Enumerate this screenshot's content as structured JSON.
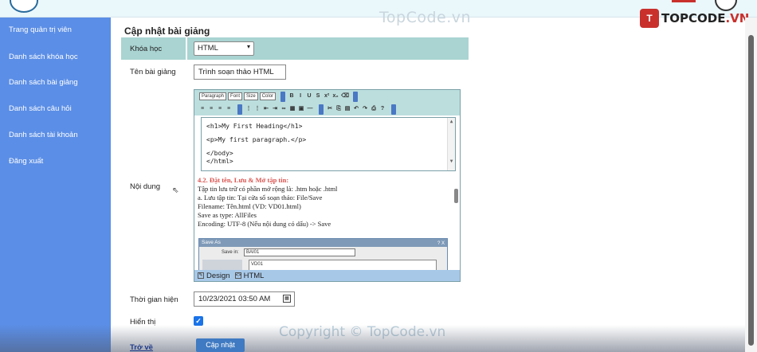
{
  "watermarks": {
    "top": "TopCode.vn",
    "bottom": "Copyright © TopCode.vn"
  },
  "brand": {
    "badge": "T",
    "text_main": "TOPCODE",
    "text_suffix": ".VN"
  },
  "sidebar": {
    "items": [
      {
        "label": "Trang quản trị viên"
      },
      {
        "label": "Danh sách khóa học"
      },
      {
        "label": "Danh sách bài giảng"
      },
      {
        "label": "Danh sách câu hỏi"
      },
      {
        "label": "Danh sách tài khoản"
      },
      {
        "label": "Đăng xuất"
      }
    ]
  },
  "page": {
    "title": "Cập nhật bài giảng"
  },
  "form": {
    "course_label": "Khóa học",
    "course_value": "HTML",
    "lesson_name_label": "Tên bài giảng",
    "lesson_name_value": "Trình soạn thảo HTML",
    "content_label": "Nội dung",
    "time_label": "Thời gian hiện",
    "time_value": "10/23/2021 03:50 AM",
    "show_label": "Hiển thị",
    "show_checked": true,
    "back_label": "Trở về",
    "submit_label": "Cập nhật"
  },
  "editor": {
    "toolbar": {
      "paragraph": "Paragraph",
      "font": "Font",
      "size": "Size",
      "color": "Color"
    },
    "code_lines": [
      "<h1>My First Heading</h1>",
      "",
      "<p>My first paragraph.</p>",
      "",
      "</body>",
      "</html>"
    ],
    "doc": {
      "heading": "4.2. Đặt tên, Lưu & Mở tập tin:",
      "lines": [
        "Tập tin lưu trữ có phần mở rộng là: .htm hoặc .html",
        "a. Lưu tập tin: Tại cửa sổ soạn thảo: File/Save",
        "Filename: Tên.html (VD: VD01.html)",
        "Save as type: AllFiles",
        "Encoding: UTF-8 (Nếu nội dung có dấu) -> Save"
      ]
    },
    "dialog": {
      "title": "Save As",
      "title_buttons": "? X",
      "save_in_label": "Save in:",
      "save_in_value": "BAI01",
      "file_item": "VD01"
    },
    "modes": {
      "design": "Design",
      "html": "HTML"
    }
  },
  "colors": {
    "sidebar": "#5b8ee6",
    "band": "#a9d4d2",
    "primary_button": "#3f7ac2",
    "checkbox": "#1a73e8",
    "doc_heading": "#d9534f"
  }
}
